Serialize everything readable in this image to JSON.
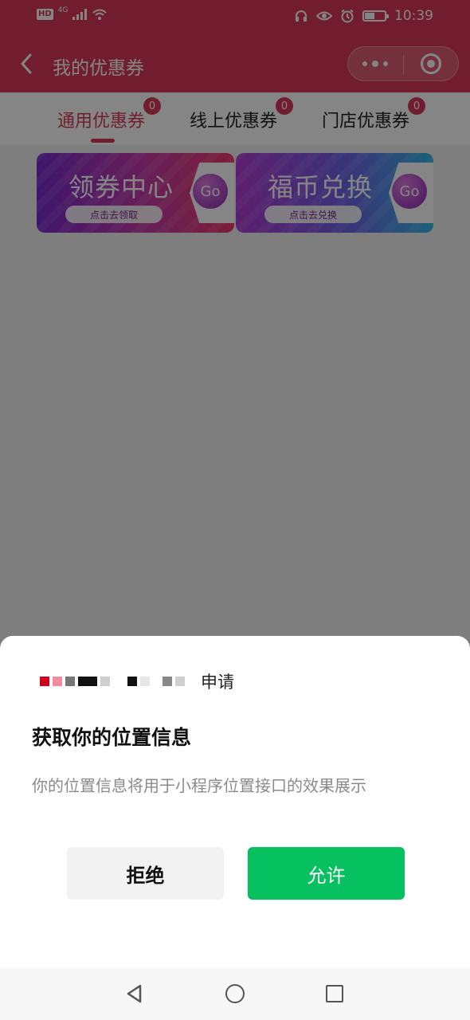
{
  "status_bar": {
    "hd": "HD",
    "network": "4G",
    "time": "10:39",
    "icons": [
      "hd-icon",
      "signal-icon",
      "wifi-icon",
      "headset-icon",
      "eye-icon",
      "alarm-icon",
      "battery-icon"
    ]
  },
  "header": {
    "title": "我的优惠券",
    "back_icon": "chevron-left-icon",
    "more_icon": "more-dots-icon",
    "close_icon": "target-close-icon"
  },
  "tabs": [
    {
      "label": "通用优惠券",
      "badge": "0",
      "active": true
    },
    {
      "label": "线上优惠券",
      "badge": "0",
      "active": false
    },
    {
      "label": "门店优惠券",
      "badge": "0",
      "active": false
    }
  ],
  "banners": [
    {
      "title": "领券中心",
      "pill": "点击去领取",
      "go": "Go"
    },
    {
      "title": "福币兑换",
      "pill": "点击去兑换",
      "go": "Go"
    }
  ],
  "permission_dialog": {
    "app_suffix": "申请",
    "title": "获取你的位置信息",
    "description": "你的位置信息将用于小程序位置接口的效果展示",
    "deny_label": "拒绝",
    "allow_label": "允许"
  },
  "colors": {
    "brand": "#d9395b",
    "allow_green": "#07c160",
    "deny_gray": "#f2f2f2"
  },
  "system_nav": {
    "icons": [
      "back-triangle-icon",
      "home-circle-icon",
      "recent-square-icon"
    ]
  }
}
